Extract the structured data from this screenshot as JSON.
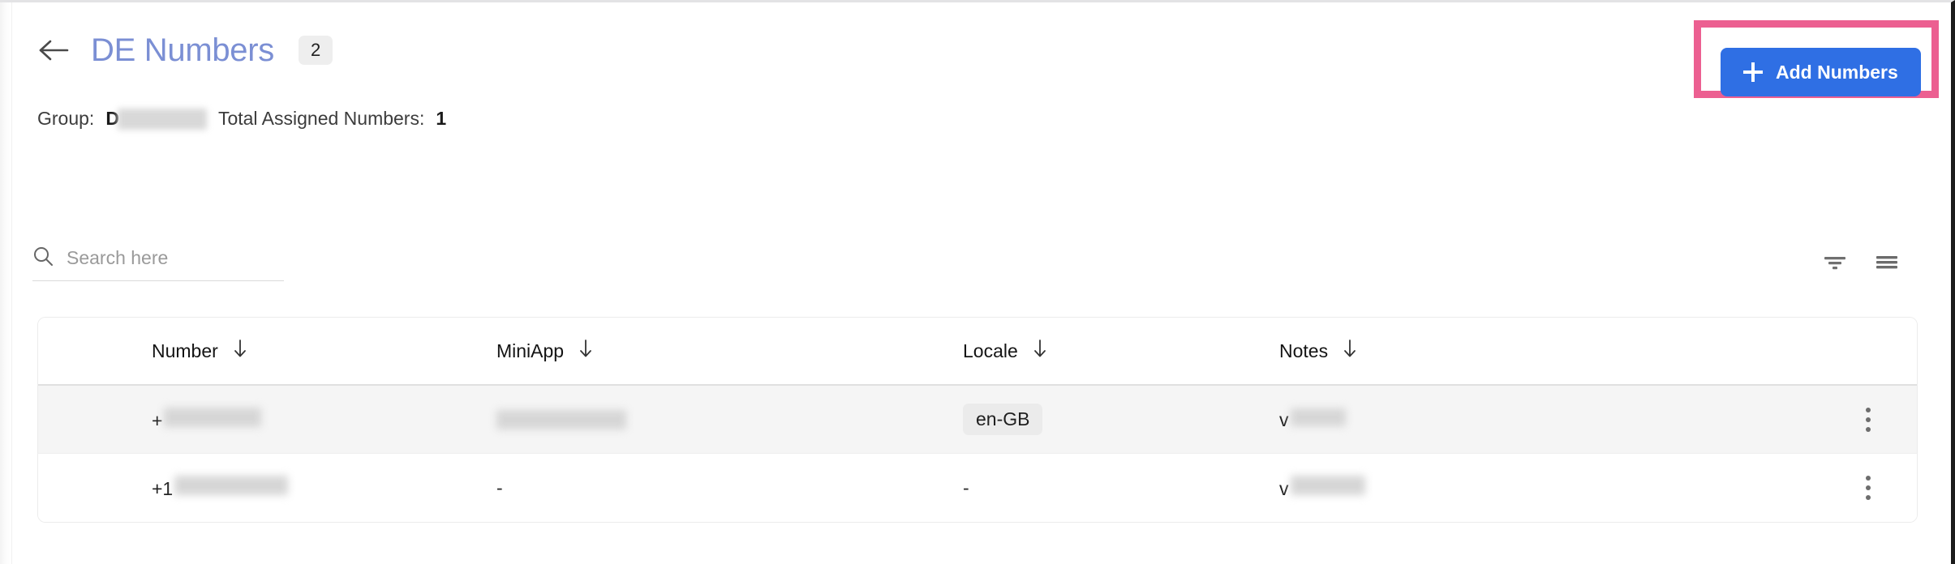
{
  "header": {
    "back_icon": "arrow-left-icon",
    "title": "DE Numbers",
    "count_badge": "2"
  },
  "subheader": {
    "group_label": "Group:",
    "group_value": "D",
    "total_label": "Total Assigned Numbers:",
    "total_value": "1"
  },
  "toolbar": {
    "add_button_label": "Add Numbers",
    "add_button_icon": "plus-icon",
    "add_button_color": "#2f6fe4",
    "highlight_color": "#ec5f91",
    "filter_icon": "filter-icon",
    "list_icon": "list-view-icon"
  },
  "search": {
    "icon": "search-icon",
    "placeholder": "Search here",
    "value": ""
  },
  "table": {
    "sort_icon": "arrow-down-icon",
    "menu_icon": "kebab-menu-icon",
    "columns": [
      {
        "key": "number",
        "label": "Number"
      },
      {
        "key": "miniapp",
        "label": "MiniApp"
      },
      {
        "key": "locale",
        "label": "Locale"
      },
      {
        "key": "notes",
        "label": "Notes"
      }
    ],
    "rows": [
      {
        "number_prefix": "+",
        "number_redacted": true,
        "miniapp": "",
        "miniapp_redacted": true,
        "locale": "en-GB",
        "locale_is_chip": true,
        "notes_prefix": "v",
        "notes_redacted": true
      },
      {
        "number_prefix": "+1",
        "number_redacted": true,
        "miniapp": "-",
        "miniapp_redacted": false,
        "locale": "-",
        "locale_is_chip": false,
        "notes_prefix": "v",
        "notes_redacted": true
      }
    ]
  }
}
